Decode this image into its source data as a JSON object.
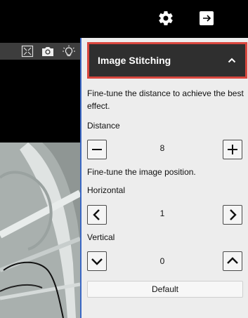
{
  "topbar": {
    "icons": [
      "gear-icon",
      "exit-icon"
    ]
  },
  "video_toolbar": {
    "icons": [
      "fullscreen-icon",
      "camera-icon",
      "light-bulb-icon"
    ]
  },
  "panel": {
    "title": "Image Stitching",
    "collapse_icon": "chevron-up-icon",
    "distance_description": "Fine-tune the distance to achieve the best effect.",
    "distance_label": "Distance",
    "distance_value": "8",
    "position_description": "Fine-tune the image position.",
    "horizontal_label": "Horizontal",
    "horizontal_value": "1",
    "vertical_label": "Vertical",
    "vertical_value": "0",
    "default_button": "Default"
  },
  "colors": {
    "highlight_border": "#d9473f",
    "panel_accent": "#3a67c4",
    "panel_bg": "#ededed"
  }
}
